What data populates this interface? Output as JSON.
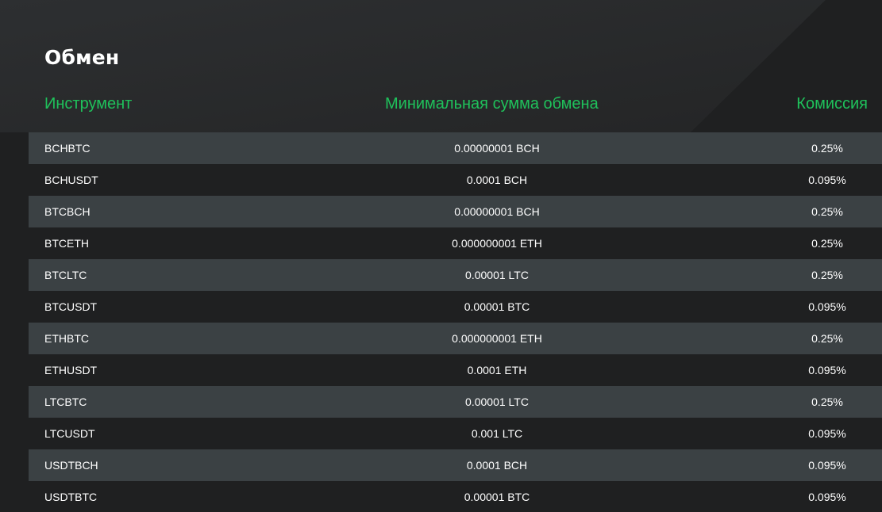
{
  "page": {
    "title": "Обмен"
  },
  "table": {
    "headers": {
      "instrument": "Инструмент",
      "min_amount": "Минимальная сумма обмена",
      "fee": "Комиссия"
    },
    "rows": [
      {
        "instrument": "BCHBTC",
        "min_amount": "0.00000001 BCH",
        "fee": "0.25%"
      },
      {
        "instrument": "BCHUSDT",
        "min_amount": "0.0001 BCH",
        "fee": "0.095%"
      },
      {
        "instrument": "BTCBCH",
        "min_amount": "0.00000001 BCH",
        "fee": "0.25%"
      },
      {
        "instrument": "BTCETH",
        "min_amount": "0.000000001 ETH",
        "fee": "0.25%"
      },
      {
        "instrument": "BTCLTC",
        "min_amount": "0.00001 LTC",
        "fee": "0.25%"
      },
      {
        "instrument": "BTCUSDT",
        "min_amount": "0.00001 BTC",
        "fee": "0.095%"
      },
      {
        "instrument": "ETHBTC",
        "min_amount": "0.000000001 ETH",
        "fee": "0.25%"
      },
      {
        "instrument": "ETHUSDT",
        "min_amount": "0.0001 ETH",
        "fee": "0.095%"
      },
      {
        "instrument": "LTCBTC",
        "min_amount": "0.00001 LTC",
        "fee": "0.25%"
      },
      {
        "instrument": "LTCUSDT",
        "min_amount": "0.001 LTC",
        "fee": "0.095%"
      },
      {
        "instrument": "USDTBCH",
        "min_amount": "0.0001 BCH",
        "fee": "0.095%"
      },
      {
        "instrument": "USDTBTC",
        "min_amount": "0.00001 BTC",
        "fee": "0.095%"
      }
    ]
  },
  "colors": {
    "accent": "#1fc15b",
    "background": "#1f2021",
    "row_alt": "#3b4144",
    "text": "#ffffff"
  }
}
